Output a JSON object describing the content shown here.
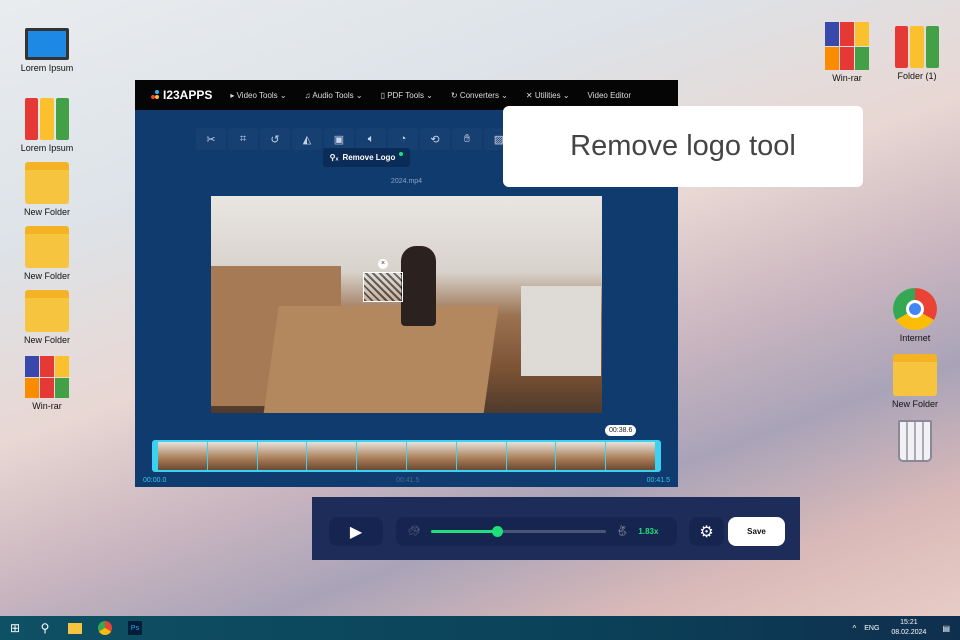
{
  "desktop": {
    "left": [
      {
        "label": "Lorem Ipsum",
        "icon": "computer-icon"
      },
      {
        "label": "Lorem Ipsum",
        "icon": "binders-icon"
      },
      {
        "label": "New Folder",
        "icon": "folder-icon"
      },
      {
        "label": "New Folder",
        "icon": "folder-icon"
      },
      {
        "label": "New Folder",
        "icon": "folder-icon"
      },
      {
        "label": "Win-rar",
        "icon": "winrar-icon"
      }
    ],
    "right": [
      {
        "label": "Win-rar"
      },
      {
        "label": "Folder (1)"
      },
      {
        "label": "Internet"
      },
      {
        "label": "New Folder"
      }
    ]
  },
  "app": {
    "logo": "I23APPS",
    "nav": [
      "Video Tools",
      "Audio Tools",
      "PDF Tools",
      "Converters",
      "Utilities",
      "Video Editor"
    ],
    "tooltip": "Remove Logo",
    "filename": "2024.mp4",
    "playhead": "00:38.6",
    "time_start": "00:00.0",
    "time_mid": "00:41.5",
    "time_end": "00:41.5"
  },
  "callout": "Remove logo tool",
  "controls": {
    "speed": "1.83x",
    "speed_fraction": 0.38,
    "save": "Save"
  },
  "taskbar": {
    "lang": "ENG",
    "time": "15:21",
    "date": "08.02.2024"
  },
  "colors": {
    "accent": "#1ee07a",
    "navy": "#0f3b6f",
    "cyan": "#3bd1f0"
  }
}
